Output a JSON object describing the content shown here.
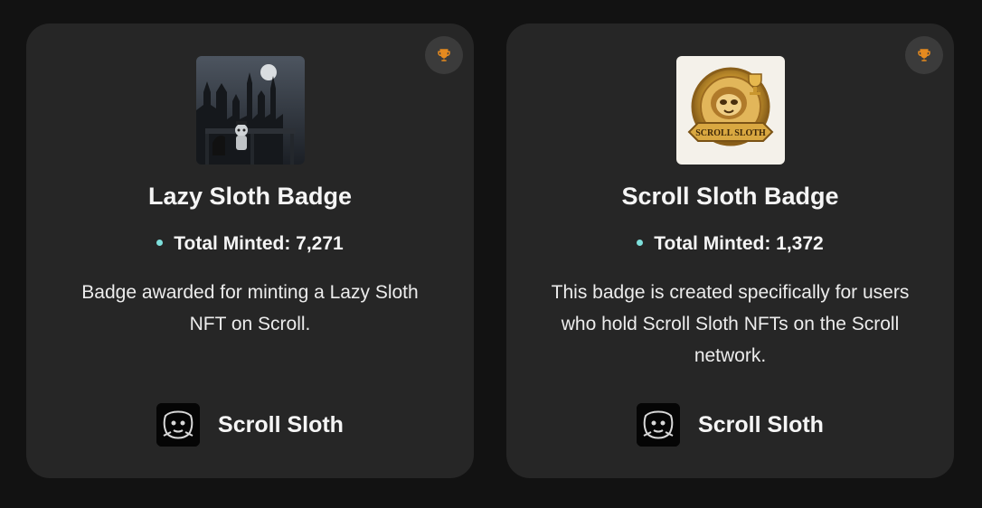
{
  "badges": [
    {
      "title": "Lazy Sloth Badge",
      "minted_label": "Total Minted: 7,271",
      "description": "Badge awarded for minting a Lazy Sloth NFT on Scroll.",
      "image_icon": "gothic-city-sloth-image",
      "issuer": "Scroll Sloth",
      "trophy_icon": "trophy-icon"
    },
    {
      "title": "Scroll Sloth Badge",
      "minted_label": "Total Minted: 1,372",
      "description": "This badge is created specifically for users who hold Scroll Sloth NFTs on the Scroll network.",
      "image_icon": "golden-sloth-emblem-image",
      "image_banner_text": "SCROLL SLOTH",
      "issuer": "Scroll Sloth",
      "trophy_icon": "trophy-icon"
    }
  ],
  "colors": {
    "background": "#121212",
    "card": "#262626",
    "accent_dot": "#7ee0dc",
    "trophy": "#e58a1f"
  }
}
